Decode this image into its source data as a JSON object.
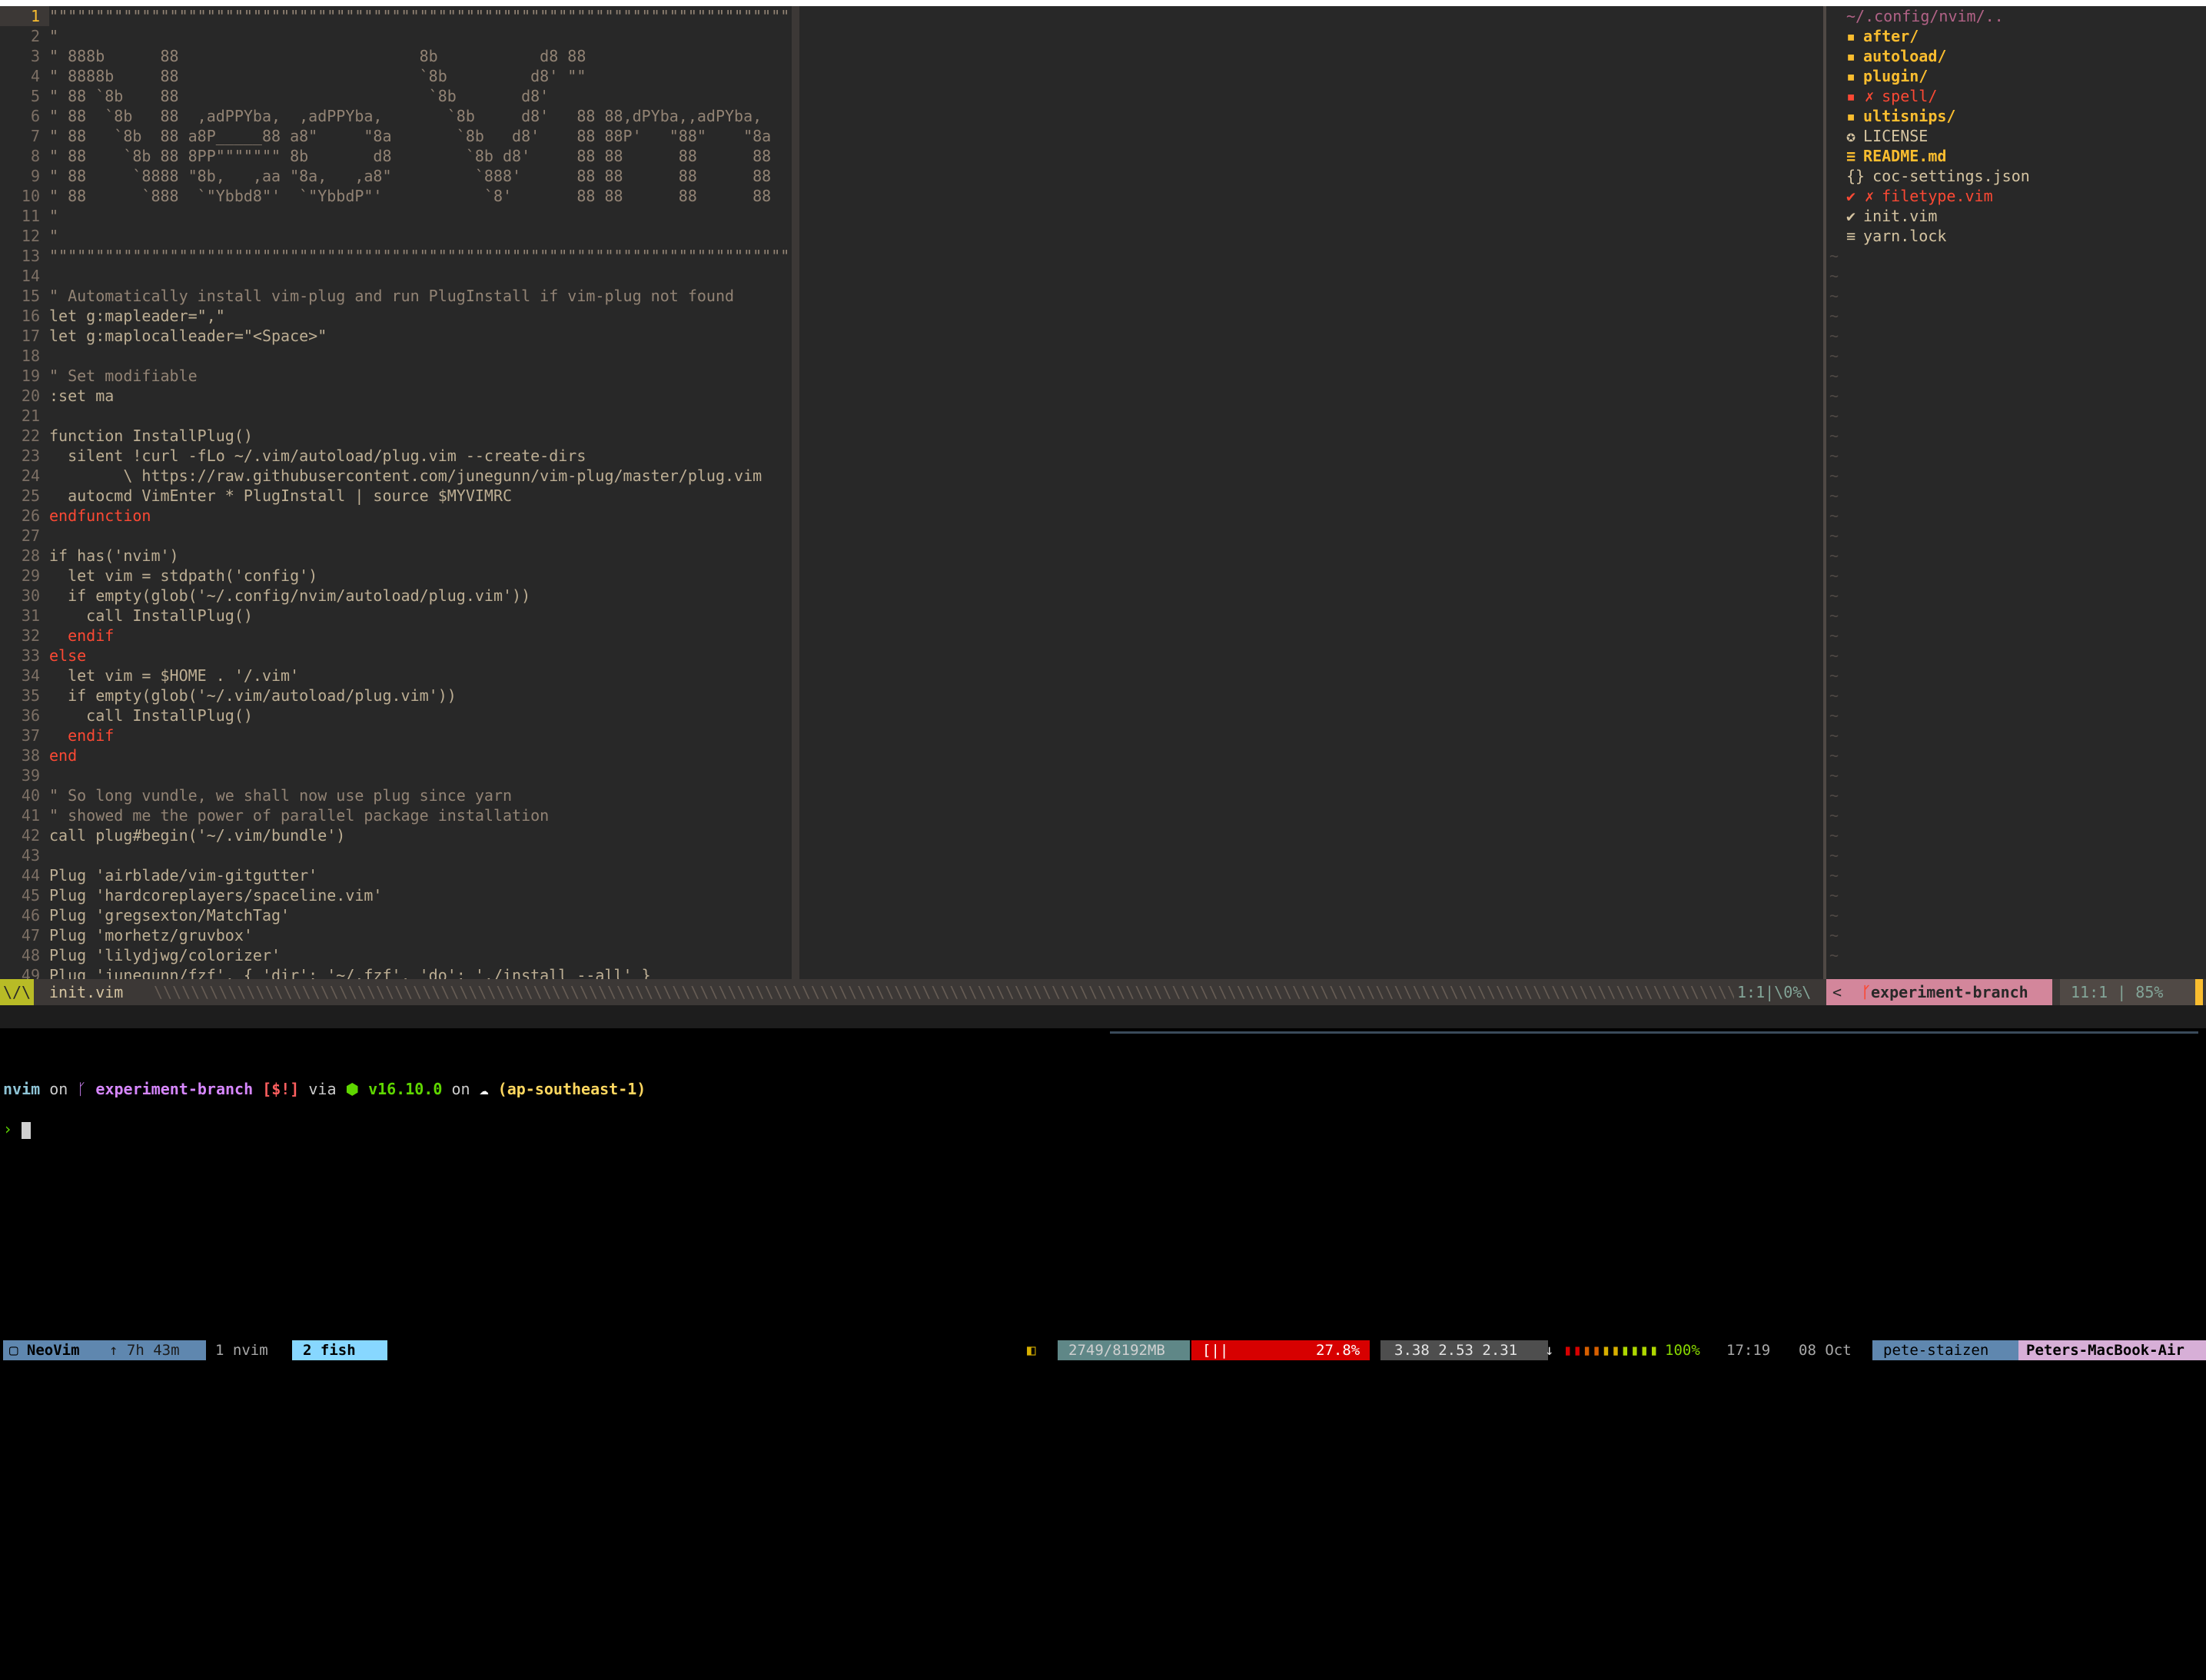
{
  "editor": {
    "lines": [
      {
        "n": "1",
        "text": "\"\"\"\"\"\"\"\"\"\"\"\"\"\"\"\"\"\"\"\"\"\"\"\"\"\"\"\"\"\"\"\"\"\"\"\"\"\"\"\"\"\"\"\"\"\"\"\"\"\"\"\"\"\"\"\"\"\"\"\"\"\"\"\"\"\"\"\"\"\"\"\"\"\"\"\"\"\"\"\"\"\"\"",
        "cls": "cm",
        "cur": true
      },
      {
        "n": "2",
        "text": "\"",
        "cls": "cm"
      },
      {
        "n": "3",
        "text": "\" 888b      88                          8b           d8 88",
        "cls": "cm"
      },
      {
        "n": "4",
        "text": "\" 8888b     88                          `8b         d8' \"\"",
        "cls": "cm"
      },
      {
        "n": "5",
        "text": "\" 88 `8b    88                           `8b       d8'",
        "cls": "cm"
      },
      {
        "n": "6",
        "text": "\" 88  `8b   88  ,adPPYba,  ,adPPYba,       `8b     d8'   88 88,dPYba,,adPYba,",
        "cls": "cm"
      },
      {
        "n": "7",
        "text": "\" 88   `8b  88 a8P_____88 a8\"     \"8a       `8b   d8'    88 88P'   \"88\"    \"8a",
        "cls": "cm"
      },
      {
        "n": "8",
        "text": "\" 88    `8b 88 8PP\"\"\"\"\"\"\" 8b       d8        `8b d8'     88 88      88      88",
        "cls": "cm"
      },
      {
        "n": "9",
        "text": "\" 88     `8888 \"8b,   ,aa \"8a,   ,a8\"         `888'      88 88      88      88",
        "cls": "cm"
      },
      {
        "n": "10",
        "text": "\" 88      `888  `\"Ybbd8\"'  `\"YbbdP\"'           `8'       88 88      88      88",
        "cls": "cm"
      },
      {
        "n": "11",
        "text": "\"",
        "cls": "cm"
      },
      {
        "n": "12",
        "text": "\"",
        "cls": "cm"
      },
      {
        "n": "13",
        "text": "\"\"\"\"\"\"\"\"\"\"\"\"\"\"\"\"\"\"\"\"\"\"\"\"\"\"\"\"\"\"\"\"\"\"\"\"\"\"\"\"\"\"\"\"\"\"\"\"\"\"\"\"\"\"\"\"\"\"\"\"\"\"\"\"\"\"\"\"\"\"\"\"\"\"\"\"\"\"\"\"\"\"\"",
        "cls": "cm"
      },
      {
        "n": "14",
        "text": "",
        "cls": "t"
      },
      {
        "n": "15",
        "text": "\" Automatically install vim-plug and run PlugInstall if vim-plug not found",
        "cls": "cm"
      },
      {
        "n": "16",
        "text": "let g:mapleader=\",\"",
        "cls": "t"
      },
      {
        "n": "17",
        "text": "let g:maplocalleader=\"<Space>\"",
        "cls": "t"
      },
      {
        "n": "18",
        "text": "",
        "cls": "t"
      },
      {
        "n": "19",
        "text": "\" Set modifiable",
        "cls": "cm"
      },
      {
        "n": "20",
        "text": ":set ma",
        "cls": "t"
      },
      {
        "n": "21",
        "text": "",
        "cls": "t"
      },
      {
        "n": "22",
        "text": "function InstallPlug()",
        "cls": "t"
      },
      {
        "n": "23",
        "text": "  silent !curl -fLo ~/.vim/autoload/plug.vim --create-dirs",
        "cls": "t"
      },
      {
        "n": "24",
        "text": "        \\ https://raw.githubusercontent.com/junegunn/vim-plug/master/plug.vim",
        "cls": "t"
      },
      {
        "n": "25",
        "text": "  autocmd VimEnter * PlugInstall | source $MYVIMRC",
        "cls": "t"
      },
      {
        "n": "26",
        "text": "endfunction",
        "cls": "kw"
      },
      {
        "n": "27",
        "text": "",
        "cls": "t"
      },
      {
        "n": "28",
        "text": "if has('nvim')",
        "cls": "t"
      },
      {
        "n": "29",
        "text": "  let vim = stdpath('config')",
        "cls": "t"
      },
      {
        "n": "30",
        "text": "  if empty(glob('~/.config/nvim/autoload/plug.vim'))",
        "cls": "t"
      },
      {
        "n": "31",
        "text": "    call InstallPlug()",
        "cls": "t"
      },
      {
        "n": "32",
        "text": "  endif",
        "cls": "kw"
      },
      {
        "n": "33",
        "text": "else",
        "cls": "kw"
      },
      {
        "n": "34",
        "text": "  let vim = $HOME . '/.vim'",
        "cls": "t"
      },
      {
        "n": "35",
        "text": "  if empty(glob('~/.vim/autoload/plug.vim'))",
        "cls": "t"
      },
      {
        "n": "36",
        "text": "    call InstallPlug()",
        "cls": "t"
      },
      {
        "n": "37",
        "text": "  endif",
        "cls": "kw"
      },
      {
        "n": "38",
        "text": "end",
        "cls": "kw"
      },
      {
        "n": "39",
        "text": "",
        "cls": "t"
      },
      {
        "n": "40",
        "text": "\" So long vundle, we shall now use plug since yarn",
        "cls": "cm"
      },
      {
        "n": "41",
        "text": "\" showed me the power of parallel package installation",
        "cls": "cm"
      },
      {
        "n": "42",
        "text": "call plug#begin('~/.vim/bundle')",
        "cls": "t"
      },
      {
        "n": "43",
        "text": "",
        "cls": "t"
      },
      {
        "n": "44",
        "text": "Plug 'airblade/vim-gitgutter'",
        "cls": "t"
      },
      {
        "n": "45",
        "text": "Plug 'hardcoreplayers/spaceline.vim'",
        "cls": "t"
      },
      {
        "n": "46",
        "text": "Plug 'gregsexton/MatchTag'",
        "cls": "t"
      },
      {
        "n": "47",
        "text": "Plug 'morhetz/gruvbox'",
        "cls": "t"
      },
      {
        "n": "48",
        "text": "Plug 'lilydjwg/colorizer'",
        "cls": "t"
      },
      {
        "n": "49",
        "text": "Plug 'junegunn/fzf', { 'dir': '~/.fzf', 'do': './install --all' }",
        "cls": "t"
      }
    ]
  },
  "tree": {
    "header": "~/.config/nvim/..",
    "items": [
      {
        "icon": "folder-icon",
        "glyph": "▪",
        "label": "after/",
        "cls": "dir"
      },
      {
        "icon": "folder-icon",
        "glyph": "▪",
        "label": "autoload/",
        "cls": "dir"
      },
      {
        "icon": "folder-icon",
        "glyph": "▪",
        "label": "plugin/",
        "cls": "dir"
      },
      {
        "icon": "error-icon",
        "glyph": "▪ ✗",
        "label": "spell/",
        "cls": "bad"
      },
      {
        "icon": "folder-icon",
        "glyph": "▪",
        "label": "ultisnips/",
        "cls": "dir"
      },
      {
        "icon": "license-icon",
        "glyph": "✪",
        "label": "LICENSE",
        "cls": "t"
      },
      {
        "icon": "markdown-icon",
        "glyph": "≡",
        "label": "README.md",
        "cls": "dir"
      },
      {
        "icon": "json-icon",
        "glyph": "{}",
        "label": "coc-settings.json",
        "cls": "t"
      },
      {
        "icon": "error-icon",
        "glyph": "✔ ✗",
        "label": "filetype.vim",
        "cls": "bad"
      },
      {
        "icon": "vim-icon",
        "glyph": "✔",
        "label": "init.vim",
        "cls": "t"
      },
      {
        "icon": "lock-icon",
        "glyph": "≡",
        "label": "yarn.lock",
        "cls": "t"
      }
    ]
  },
  "statusline": {
    "mode": "\\/\\",
    "filename": "init.vim",
    "position": "1:1|\\0%\\",
    "branch": "experiment-branch",
    "cursor_pos": "11:1 | 85%"
  },
  "terminal": {
    "dir": "nvim",
    "on": "on",
    "branch": "experiment-branch",
    "git_status": "[$!]",
    "via": "via",
    "node": "v16.10.0",
    "on2": "on",
    "region": "(ap-southeast-1)",
    "prompt": "›"
  },
  "tmux": {
    "session": "NeoVim",
    "uptime": "↑ 7h 43m",
    "window1": "1 nvim",
    "window2": "2 fish",
    "mem": "2749/8192MB",
    "cpu_bar": "[||          ]",
    "cpu": "27.8%",
    "load": "3.38 2.53 2.31",
    "battery": "100%",
    "time": "17:19",
    "date": "08 Oct",
    "user": "pete-staizen",
    "host": "Peters-MacBook-Air"
  }
}
